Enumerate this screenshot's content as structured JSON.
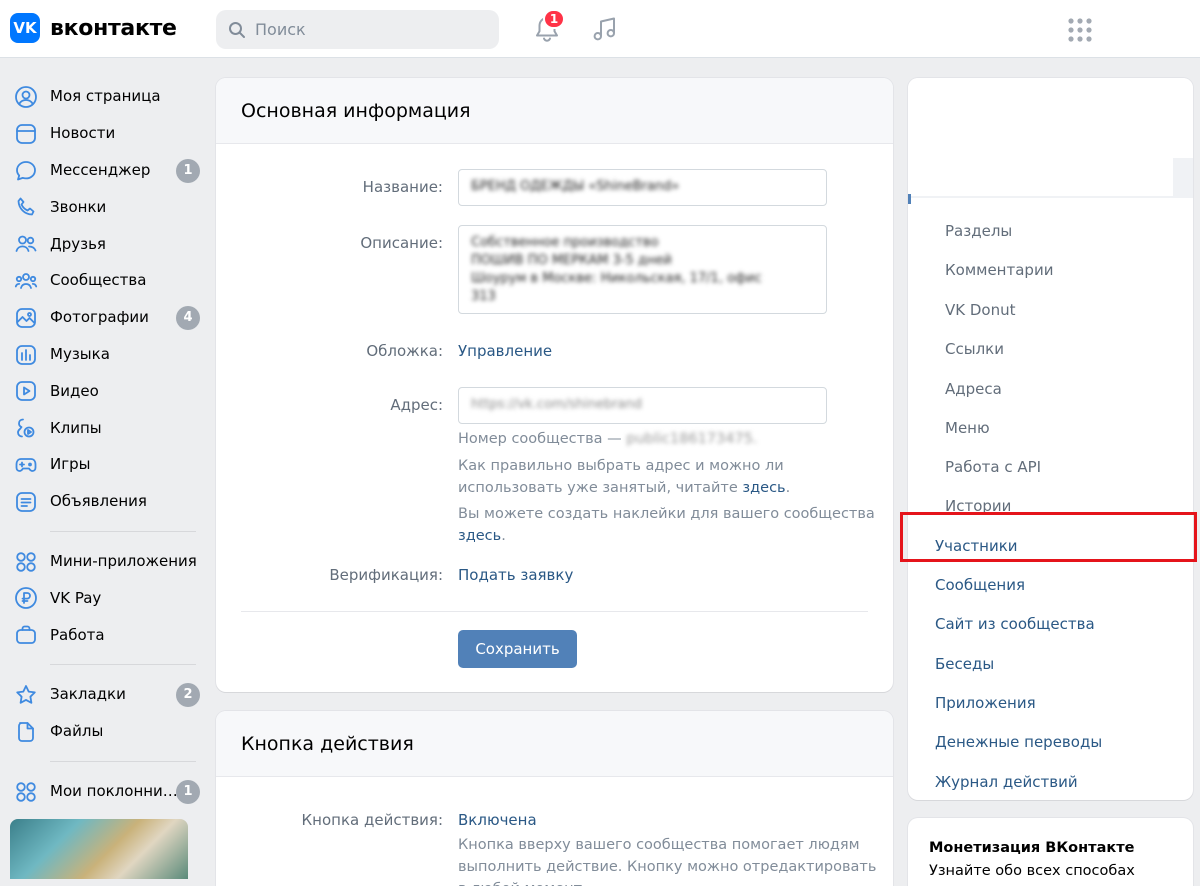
{
  "header": {
    "logo_mark": "VK",
    "logo_text": "вконтакте",
    "search_placeholder": "Поиск",
    "notifications_count": "1"
  },
  "leftnav": {
    "items": [
      {
        "label": "Моя страница",
        "icon": "user-icon",
        "badge": ""
      },
      {
        "label": "Новости",
        "icon": "news-icon",
        "badge": ""
      },
      {
        "label": "Мессенджер",
        "icon": "chat-icon",
        "badge": "1"
      },
      {
        "label": "Звонки",
        "icon": "phone-icon",
        "badge": ""
      },
      {
        "label": "Друзья",
        "icon": "friends-icon",
        "badge": ""
      },
      {
        "label": "Сообщества",
        "icon": "communities-icon",
        "badge": ""
      },
      {
        "label": "Фотографии",
        "icon": "photo-icon",
        "badge": "4"
      },
      {
        "label": "Музыка",
        "icon": "music-icon",
        "badge": ""
      },
      {
        "label": "Видео",
        "icon": "video-icon",
        "badge": ""
      },
      {
        "label": "Клипы",
        "icon": "clips-icon",
        "badge": ""
      },
      {
        "label": "Игры",
        "icon": "gamepad-icon",
        "badge": ""
      },
      {
        "label": "Объявления",
        "icon": "ads-icon",
        "badge": ""
      }
    ],
    "items2": [
      {
        "label": "Мини-приложения",
        "icon": "apps-icon",
        "badge": ""
      },
      {
        "label": "VK Pay",
        "icon": "vkpay-icon",
        "badge": ""
      },
      {
        "label": "Работа",
        "icon": "briefcase-icon",
        "badge": ""
      }
    ],
    "items3": [
      {
        "label": "Закладки",
        "icon": "star-icon",
        "badge": "2"
      },
      {
        "label": "Файлы",
        "icon": "file-icon",
        "badge": ""
      }
    ],
    "items4": [
      {
        "label": "Мои поклонни…",
        "icon": "apps-icon",
        "badge": "1"
      }
    ]
  },
  "main": {
    "basic_info": {
      "title": "Основная информация",
      "name_label": "Название:",
      "name_value": "БРЕНД ОДЕЖДЫ «ShineBrand»",
      "desc_label": "Описание:",
      "desc_lines": [
        "Собственное производство",
        "ПОШИВ ПО МЕРКАМ 3-5 дней",
        "Шоурум в Москве: Никольская, 17/1, офис",
        "313"
      ],
      "cover_label": "Обложка:",
      "cover_link": "Управление",
      "address_label": "Адрес:",
      "address_value": "https://vk.com/shinebrand",
      "community_number_text": "Номер сообщества — ",
      "community_number_value": "public186173475.",
      "address_hint": "Как правильно выбрать адрес и можно ли использовать уже занятый, читайте ",
      "address_hint_link": "здесь",
      "stickers_hint": "Вы можете создать наклейки для вашего сообщества ",
      "stickers_hint_link": "здесь",
      "verification_label": "Верификация:",
      "verification_link": "Подать заявку",
      "save_label": "Сохранить"
    },
    "action_button": {
      "title": "Кнопка действия",
      "label": "Кнопка действия:",
      "value": "Включена",
      "hint": "Кнопка вверху вашего сообщества помогает людям выполнить действие. Кнопку можно отредактировать в любой момент."
    }
  },
  "rightnav": {
    "muted_items": [
      "Разделы",
      "Комментарии",
      "VK Donut",
      "Ссылки",
      "Адреса",
      "Меню",
      "Работа с API",
      "Истории"
    ],
    "link_items": [
      "Участники",
      "Сообщения",
      "Сайт из сообщества",
      "Беседы",
      "Приложения",
      "Денежные переводы",
      "Журнал действий"
    ],
    "highlighted": "Участники"
  },
  "monetization": {
    "title": "Монетизация ВКонтакте",
    "subtitle": "Узнайте обо всех способах"
  },
  "colors": {
    "accent": "#0077ff",
    "link": "#2a5885",
    "button": "#5181b8",
    "highlight_border": "#e5141b",
    "badge": "#a2a9b2",
    "notification": "#ff3347"
  }
}
